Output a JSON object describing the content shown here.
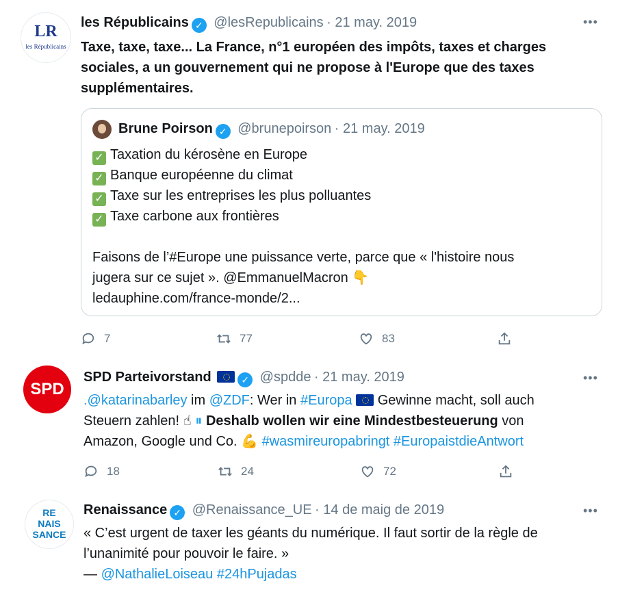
{
  "tweets": [
    {
      "name": "les Républicains",
      "handle": "@lesRepublicains",
      "date": "· 21 may. 2019",
      "text": "Taxe, taxe, taxe... La France, n°1 européen des impôts, taxes et charges sociales, a un gouvernement qui ne propose à l'Europe que des taxes supplémentaires.",
      "avatar_text": "LR",
      "avatar_sub": "les Républicains",
      "quote": {
        "name": "Brune Poirson",
        "handle": "@brunepoirson",
        "date": "· 21 may. 2019",
        "items": [
          "Taxation du kérosène en Europe",
          "Banque européenne du climat",
          "Taxe sur les entreprises les plus polluantes",
          "Taxe carbone aux frontières"
        ],
        "body_1": "Faisons de l’#Europe une puissance verte, parce que « l'histoire nous",
        "body_2": "jugera sur ce sujet ». @EmmanuelMacron",
        "link": "ledauphine.com/france-monde/2..."
      },
      "replies": "7",
      "retweets": "77",
      "likes": "83"
    },
    {
      "name": "SPD Parteivorstand",
      "handle": "@spdde",
      "date": "· 21 may. 2019",
      "avatar_text": "SPD",
      "line1": {
        "mention1": ".@katarinabarley",
        "t1": " im ",
        "mention2": "@ZDF",
        "t2": ": Wer in ",
        "hashtag": "#Europa",
        "t3": " Gewinne macht, soll auch"
      },
      "line2": {
        "t1": "Steuern zahlen! ",
        "bold": "Deshalb wollen wir eine Mindestbesteuerung",
        "t2": " von"
      },
      "line3": {
        "t1": "Amazon, Google und Co. ",
        "hashtags": "#wasmireuropabringt #EuropaistdieAntwort"
      },
      "replies": "18",
      "retweets": "24",
      "likes": "72"
    },
    {
      "name": "Renaissance",
      "handle": "@Renaissance_UE",
      "date": "· 14 de maig de 2019",
      "avatar_lines": [
        "RE",
        "NAIS",
        "SANCE"
      ],
      "line1": "« C’est urgent de taxer les géants du numérique. Il faut sortir de la règle de",
      "line2": "l’unanimité pour pouvoir le faire. »",
      "line3_prefix": "— ",
      "line3_links": "@NathalieLoiseau #24hPujadas"
    }
  ],
  "colors": {
    "link": "#1b95e0",
    "verified": "#1da1f2",
    "spd_red": "#e3000f",
    "renaissance_blue": "#0b7ac1",
    "lr_blue": "#1e3a8a",
    "lr_red": "#d51f2b"
  },
  "icons": [
    "reply-icon",
    "retweet-icon",
    "like-icon",
    "share-icon",
    "verified-icon",
    "more-icon",
    "check-icon",
    "eu-flag-icon"
  ]
}
